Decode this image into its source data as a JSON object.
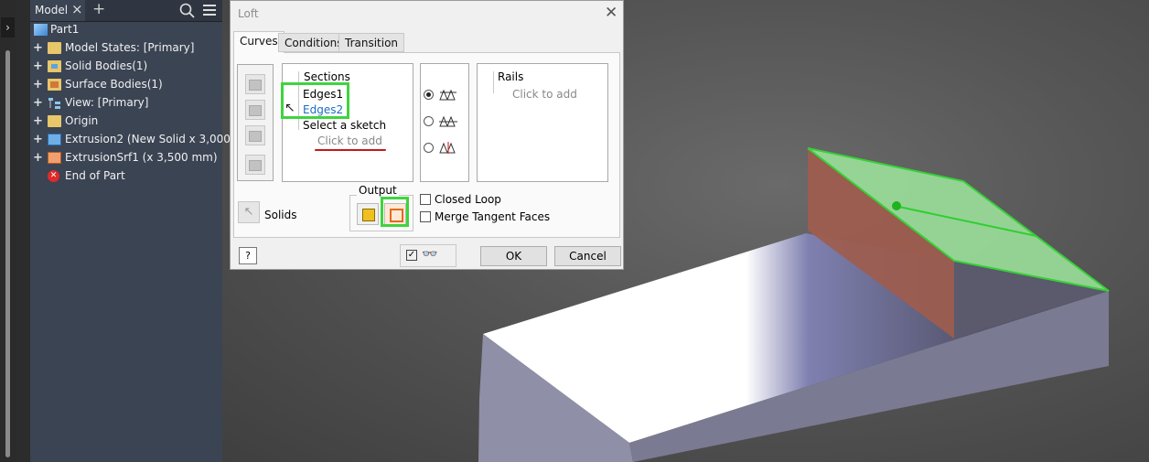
{
  "browser": {
    "tab_label": "Model",
    "tree": [
      {
        "label": "Part1",
        "icon": "part-cube-icon",
        "expander": ""
      },
      {
        "label": "Model States: [Primary]",
        "icon": "folder-icon",
        "expander": "+"
      },
      {
        "label": "Solid Bodies(1)",
        "icon": "solid-bodies-folder-icon",
        "expander": "+"
      },
      {
        "label": "Surface Bodies(1)",
        "icon": "surface-bodies-folder-icon",
        "expander": "+"
      },
      {
        "label": "View: [Primary]",
        "icon": "view-icon",
        "expander": "+"
      },
      {
        "label": "Origin",
        "icon": "folder-icon",
        "expander": "+"
      },
      {
        "label": "Extrusion2 (New Solid x 3,000",
        "icon": "extrusion-icon",
        "expander": "+"
      },
      {
        "label": "ExtrusionSrf1 (x 3,500 mm)",
        "icon": "surface-extrusion-icon",
        "expander": "+"
      },
      {
        "label": "End of Part",
        "icon": "end-of-part-icon",
        "expander": ""
      }
    ]
  },
  "dialog": {
    "title": "Loft",
    "tabs": [
      "Curves",
      "Conditions",
      "Transition"
    ],
    "sections": {
      "header": "Sections",
      "items": [
        "Edges1",
        "Edges2"
      ],
      "prompt": "Select a sketch",
      "add": "Click to add"
    },
    "rails": {
      "header": "Rails",
      "add": "Click to add"
    },
    "solids_label": "Solids",
    "output_label": "Output",
    "closed_loop": "Closed Loop",
    "merge_tangent": "Merge Tangent Faces",
    "ok": "OK",
    "cancel": "Cancel",
    "help": "?",
    "selected_mode": "rails"
  },
  "colors": {
    "highlight": "#3fd43f",
    "link": "#1a6ec6",
    "underline": "#c21a1a"
  }
}
